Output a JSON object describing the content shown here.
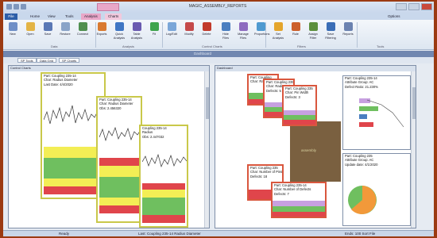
{
  "window": {
    "title": "MAGIC_ASSEMBLY_REPORTS"
  },
  "ribbon_tabs": [
    "File",
    "Home",
    "View",
    "Tools",
    "Analysis",
    "Charts",
    "Options"
  ],
  "ribbon_buttons": [
    {
      "label": "New",
      "color": "#6f8fc7"
    },
    {
      "label": "Open",
      "color": "#e3b445"
    },
    {
      "label": "Save",
      "color": "#5a78b5"
    },
    {
      "label": "Restore",
      "color": "#8aa4c8"
    },
    {
      "label": "Connect",
      "color": "#4f8f4f"
    },
    {
      "label": "Exports",
      "color": "#d97a30"
    },
    {
      "label": "Quick Analysis",
      "color": "#3f76c4"
    },
    {
      "label": "Table Analysis",
      "color": "#6a5ab0"
    },
    {
      "label": "Fit",
      "color": "#3ea44c"
    },
    {
      "label": "Log/Edit",
      "color": "#7aa6d8"
    },
    {
      "label": "Modify",
      "color": "#c54a4a"
    },
    {
      "label": "Delete",
      "color": "#c23a2a"
    },
    {
      "label": "Hide Files",
      "color": "#4a7ec0"
    },
    {
      "label": "Manage Files",
      "color": "#8e6bbf"
    },
    {
      "label": "Proportions",
      "color": "#4f9ad0"
    },
    {
      "label": "Set Analysis",
      "color": "#e4a52c"
    },
    {
      "label": "Rule",
      "color": "#cc5f2a"
    },
    {
      "label": "Assign Filter",
      "color": "#5c8f3c"
    },
    {
      "label": "Save Filtering",
      "color": "#3a6db6"
    },
    {
      "label": "Reports",
      "color": "#6b82b0"
    }
  ],
  "group_labels": [
    "Data",
    "Analysis",
    "Control Charts",
    "Filters",
    "Tools"
  ],
  "doc_tabs": [
    "SP Tools",
    "Data Grid",
    "SP Charts"
  ],
  "left_panel": {
    "title": "Control Charts",
    "cards": [
      {
        "lines": [
          "Part: Coupling 235-14",
          "Char: Radius Diameter",
          "Last Date: 4/4/2020"
        ]
      },
      {
        "lines": [
          "Part: Coupling 235-14",
          "Char: Radius Diameter",
          "Obs: 2.456320"
        ]
      },
      {
        "lines": [
          "Coupling 235-14",
          "Radius",
          "Obs: 2.447032"
        ]
      }
    ]
  },
  "right_panel": {
    "title": "Dashboard",
    "small_cards": [
      {
        "lines": [
          "Part: Coupling",
          "Char: Radius"
        ]
      },
      {
        "lines": [
          "Part: Coupling 235",
          "Char: Radius Dia",
          "Defects: 5"
        ]
      },
      {
        "lines": [
          "Part: Coupling 235",
          "Char: Pin Width",
          "Defects: 3"
        ]
      }
    ],
    "info_top": [
      {
        "text": "Part: Coupling 235-14"
      },
      {
        "text": "Attribute Group: AC"
      },
      {
        "text": "Defect Ratio: 21.230%"
      }
    ],
    "info_bottom": [
      {
        "text": "Part: Coupling 235"
      },
      {
        "text": "Attribute Group: AC"
      },
      {
        "text": "Update date: 4/1/2020"
      }
    ],
    "red_cards": [
      {
        "lines": [
          "Part: Coupling 235",
          "Char: Number of Pins",
          "Defects: 18"
        ]
      },
      {
        "lines": [
          "Part: Coupling 235-14",
          "Char: Number of Defects",
          "Defects: 7"
        ]
      }
    ],
    "brown_label": "assembly"
  },
  "status_bar": {
    "left": "Ready",
    "middle": "Last: Coupling 235-14 Radius Diameter",
    "right": "Ends: 100 Sort File"
  },
  "colors": {
    "frame": "#9b3a12",
    "title_bar": "#c9d8ec",
    "file_tab": "#2d5ea8",
    "card_yellow_border": "#c9c84a",
    "card_red_border": "#d9573e",
    "band_yellow": "#f3ee55",
    "band_green": "#6fbf5f",
    "band_red": "#e0454b"
  }
}
